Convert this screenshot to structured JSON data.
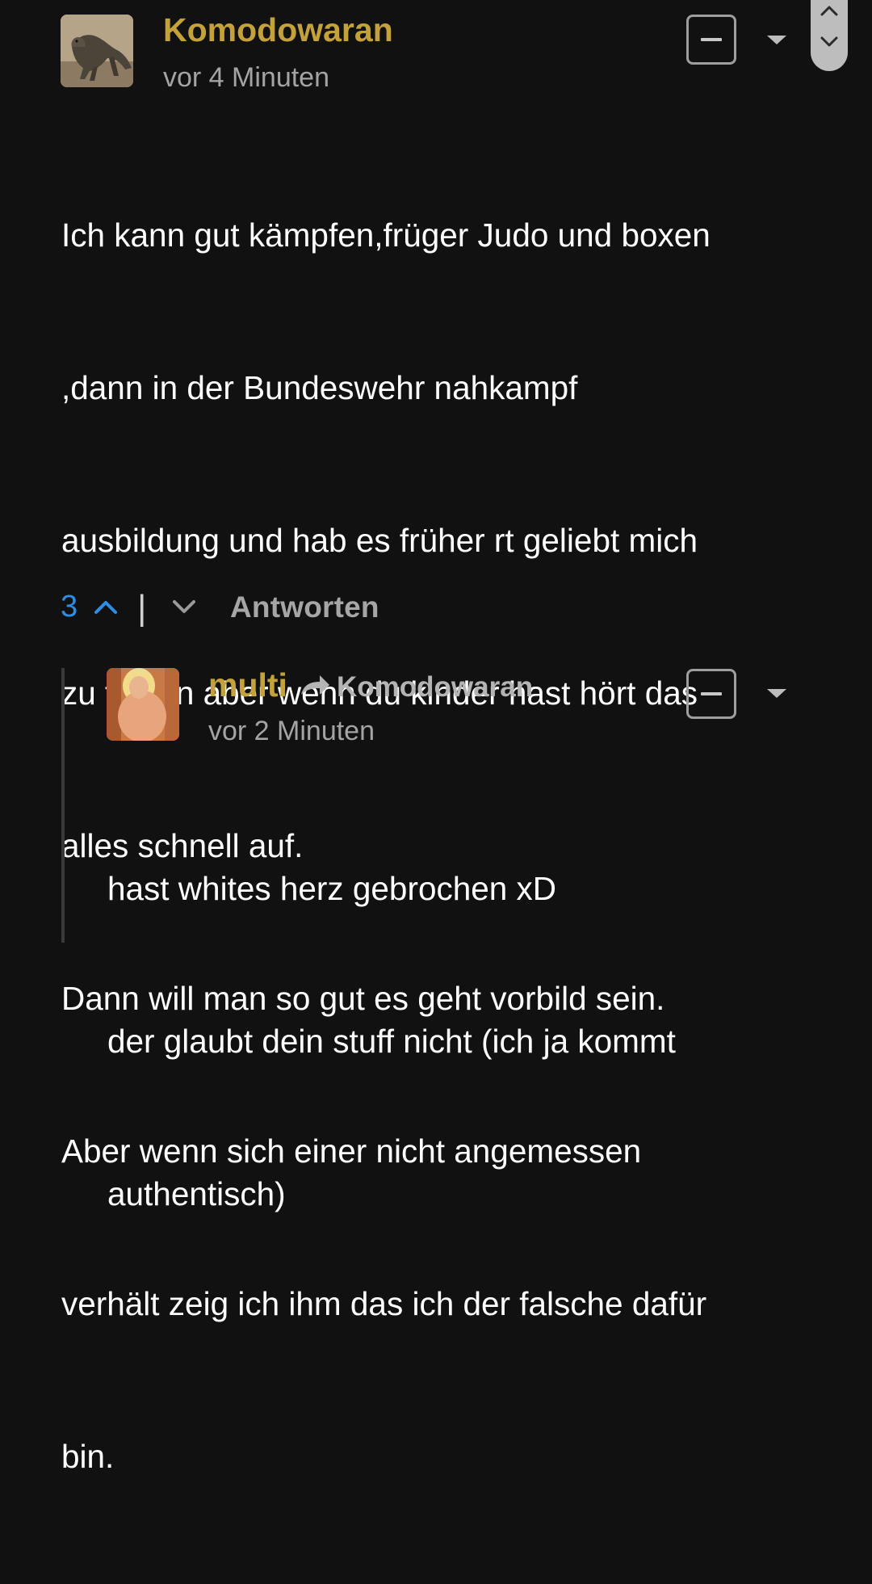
{
  "comment": {
    "author": "Komodowaran",
    "time": "vor 4 Minuten",
    "avatar_icon": "komodo-dragon-avatar",
    "lines": [
      "Ich kann gut kämpfen,früger Judo und boxen",
      ",dann in der Bundeswehr nahkampf",
      "ausbildung und hab es früher rt geliebt mich",
      "zu fetzen aber wenn du kinder hast hört das",
      "alles schnell auf.",
      "Dann will man so gut es geht vorbild sein.",
      "Aber wenn sich einer nicht angemessen",
      "verhält zeig ich ihm das ich der falsche dafür",
      "bin."
    ],
    "votes": "3",
    "vote_separator": "|",
    "reply_label": "Antworten",
    "collapse_icon": "minus-icon",
    "menu_icon": "caret-down-icon"
  },
  "reply": {
    "author": "multi",
    "reply_arrow_icon": "reply-arrow-icon",
    "reply_to": "Komodowaran",
    "time": "vor 2 Minuten",
    "avatar_icon": "user-photo-avatar",
    "lines": [
      "hast whites herz gebrochen xD",
      "der glaubt dein stuff nicht (ich ja kommt",
      "authentisch)"
    ]
  },
  "scroll": {
    "up_icon": "chevron-up-icon",
    "down_icon": "chevron-down-icon"
  },
  "colors": {
    "background": "#111112",
    "author": "#c4a23b",
    "vote_count": "#2e8ee6",
    "muted": "#a4a4a4"
  }
}
